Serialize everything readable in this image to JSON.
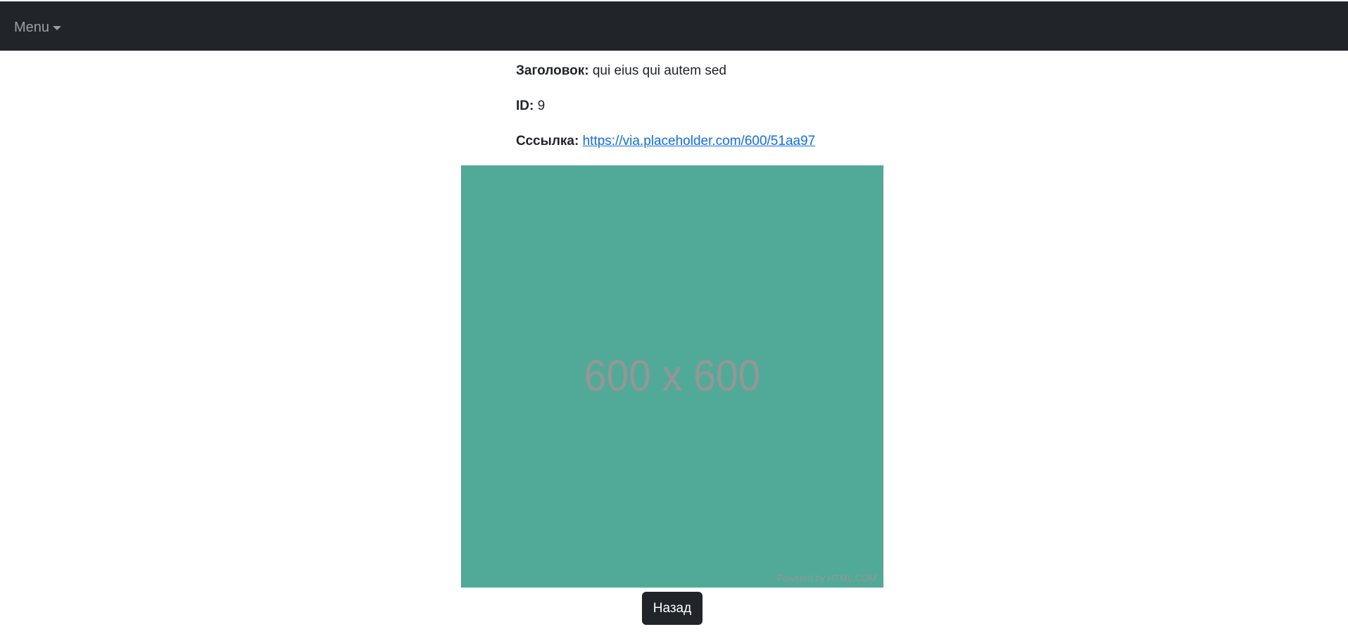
{
  "navbar": {
    "menu_label": "Menu"
  },
  "details": {
    "title_label": "Заголовок:",
    "title_value": "qui eius qui autem sed",
    "id_label": "ID:",
    "id_value": "9",
    "link_label": "Сссылка:",
    "link_value": "https://via.placeholder.com/600/51aa97"
  },
  "image": {
    "dimension_text": "600 x 600",
    "credit_text": "Powered by HTML.COM",
    "background_color": "#51aa97"
  },
  "actions": {
    "back_label": "Назад"
  }
}
